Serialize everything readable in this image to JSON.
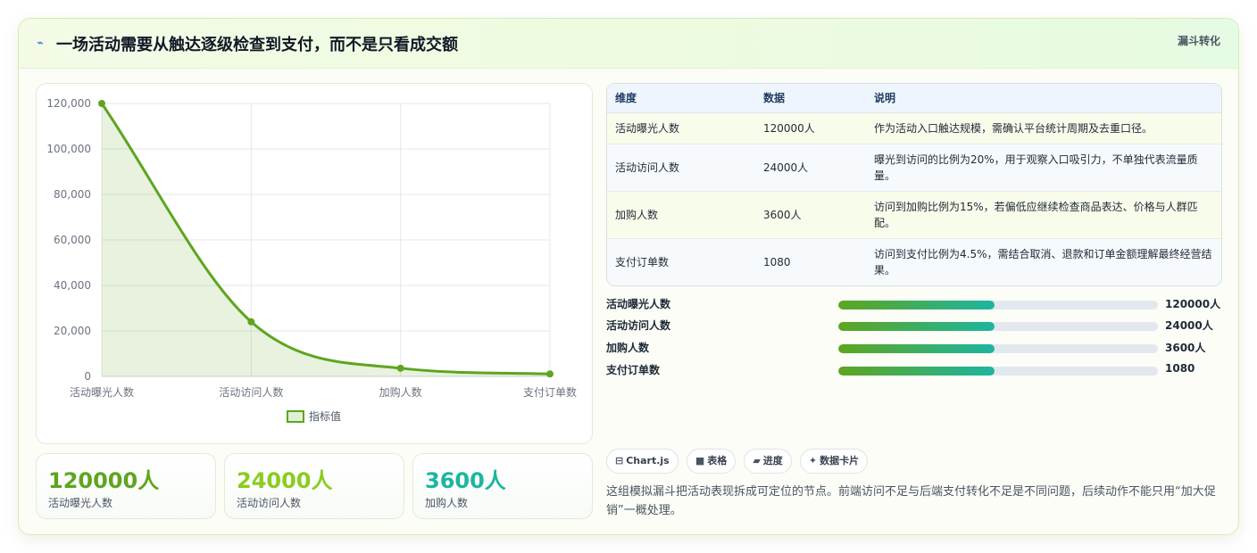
{
  "header": {
    "icon": "⌁",
    "title": "一场活动需要从触达逐级检查到支付，而不是只看成交额",
    "tag": "漏斗转化"
  },
  "chart_data": {
    "type": "line",
    "categories": [
      "活动曝光人数",
      "活动访问人数",
      "加购人数",
      "支付订单数"
    ],
    "series": [
      {
        "name": "指标值",
        "values": [
          120000,
          24000,
          3600,
          1080
        ]
      }
    ],
    "ylim": [
      0,
      120000
    ],
    "yticks": [
      "0",
      "20,000",
      "40,000",
      "60,000",
      "80,000",
      "100,000",
      "120,000"
    ],
    "ytick_values": [
      0,
      20000,
      40000,
      60000,
      80000,
      100000,
      120000
    ],
    "fill": true,
    "grid": true,
    "legend": "bottom",
    "color": "#5ea51f"
  },
  "kpis": [
    {
      "value": "120000人",
      "label": "活动曝光人数",
      "color": "#5ea51f"
    },
    {
      "value": "24000人",
      "label": "活动访问人数",
      "color": "#8bcc1f"
    },
    {
      "value": "3600人",
      "label": "加购人数",
      "color": "#1db5a0"
    }
  ],
  "table": {
    "headers": [
      "维度",
      "数据",
      "说明"
    ],
    "rows": [
      {
        "dim": "活动曝光人数",
        "value": "120000人",
        "desc": "作为活动入口触达规模，需确认平台统计周期及去重口径。"
      },
      {
        "dim": "活动访问人数",
        "value": "24000人",
        "desc": "曝光到访问的比例为20%，用于观察入口吸引力，不单独代表流量质量。"
      },
      {
        "dim": "加购人数",
        "value": "3600人",
        "desc": "访问到加购比例为15%，若偏低应继续检查商品表达、价格与人群匹配。"
      },
      {
        "dim": "支付订单数",
        "value": "1080",
        "desc": "访问到支付比例为4.5%，需结合取消、退款和订单金额理解最终经营结果。"
      }
    ]
  },
  "progress": [
    {
      "label": "活动曝光人数",
      "value": "120000人",
      "fill": 0.49
    },
    {
      "label": "活动访问人数",
      "value": "24000人",
      "fill": 0.49
    },
    {
      "label": "加购人数",
      "value": "3600人",
      "fill": 0.49
    },
    {
      "label": "支付订单数",
      "value": "1080",
      "fill": 0.49
    }
  ],
  "chips": [
    {
      "icon": "⊟",
      "label": "Chart.js"
    },
    {
      "icon": "■",
      "label": "表格"
    },
    {
      "icon": "▰",
      "label": "进度"
    },
    {
      "icon": "✦",
      "label": "数据卡片"
    }
  ],
  "note": "这组模拟漏斗把活动表现拆成可定位的节点。前端访问不足与后端支付转化不足是不同问题，后续动作不能只用“加大促销”一概处理。"
}
